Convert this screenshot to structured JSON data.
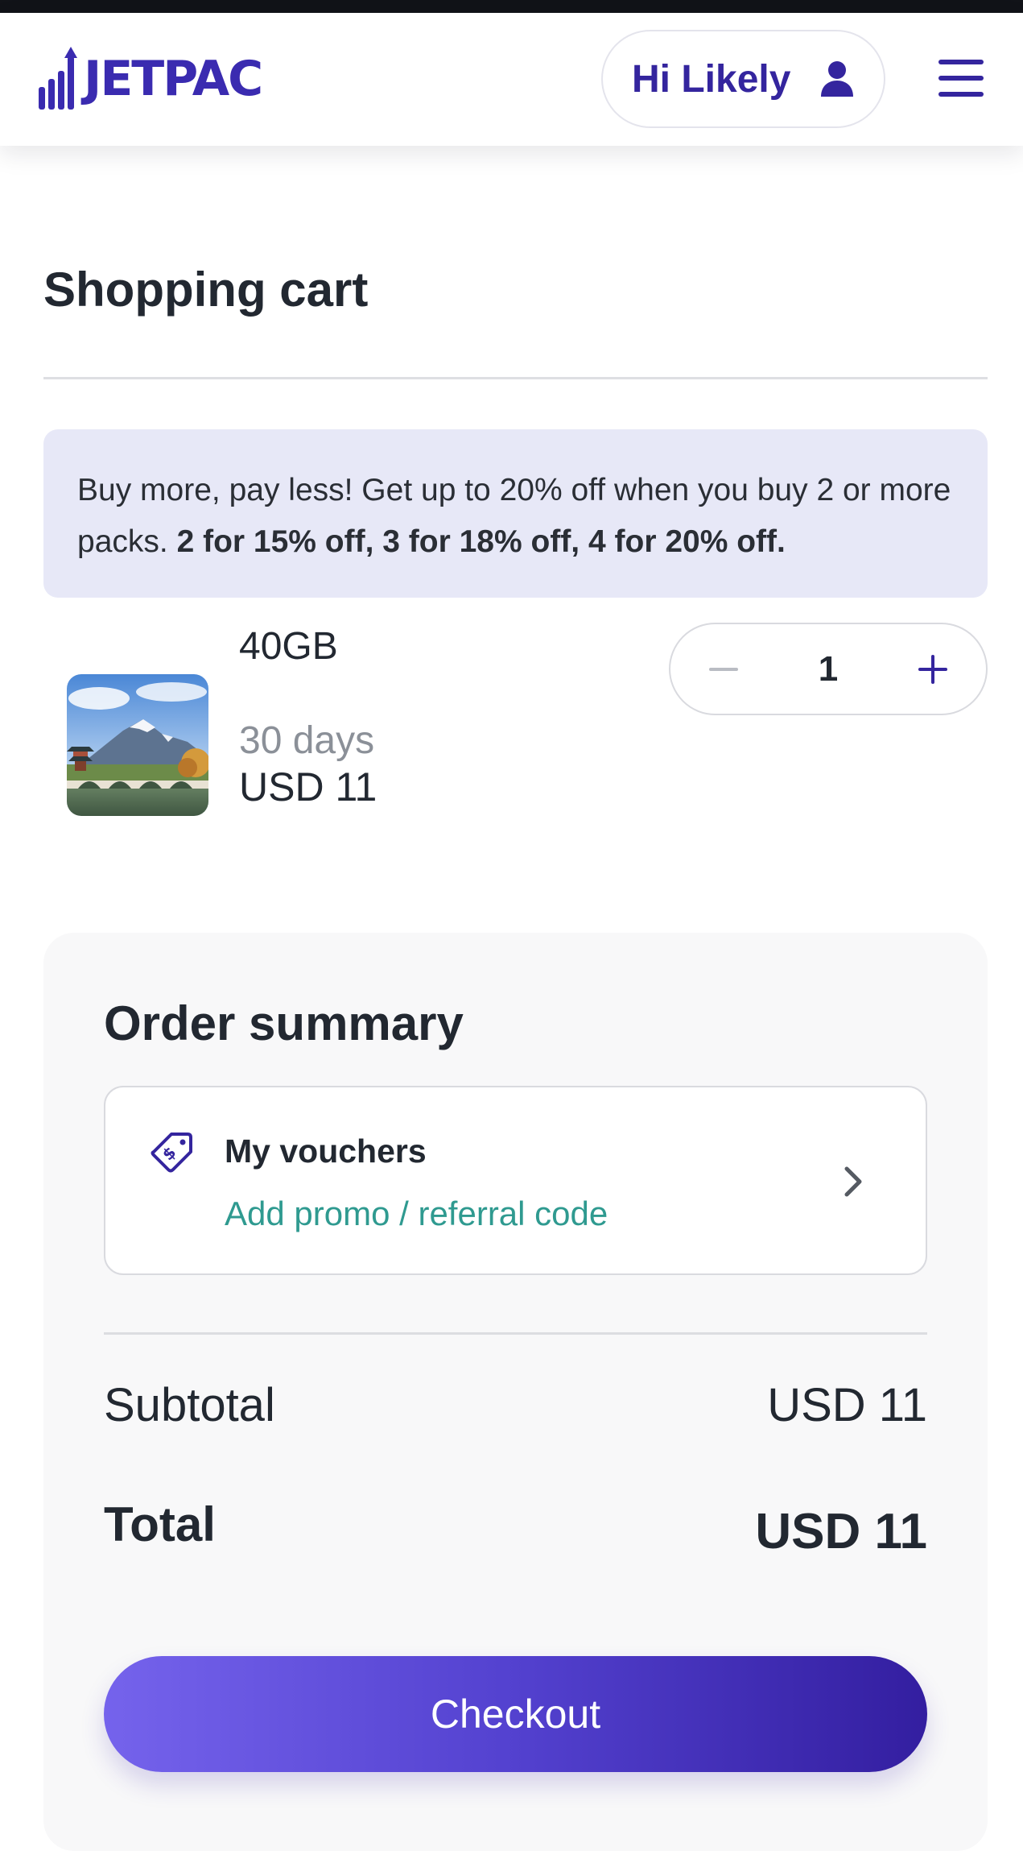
{
  "header": {
    "logo_text": "JETPAC",
    "greeting": "Hi Likely",
    "user_icon": "user-icon",
    "menu_icon": "hamburger-menu-icon"
  },
  "cart": {
    "title": "Shopping cart",
    "promo": {
      "lead": "Buy more, pay less! Get up to 20% off when you buy 2 or more packs.",
      "tiers": "2 for 15% off, 3 for 18% off, 4 for 20% off."
    },
    "item": {
      "name": "40GB",
      "duration": "30 days",
      "price": "USD 11",
      "quantity": "1",
      "decrement_icon": "minus-icon",
      "increment_icon": "plus-icon"
    }
  },
  "summary": {
    "title": "Order summary",
    "voucher": {
      "title": "My vouchers",
      "subtitle": "Add promo / referral code",
      "icon": "voucher-tag-icon",
      "chevron": "chevron-right-icon"
    },
    "subtotal_label": "Subtotal",
    "subtotal_value": "USD 11",
    "total_label": "Total",
    "total_value": "USD 11",
    "checkout_label": "Checkout"
  },
  "colors": {
    "brand": "#34259e",
    "promo_bg": "#e7e8f7",
    "link_teal": "#2f9a90",
    "checkout_start": "#7563ec",
    "checkout_end": "#331ea0"
  }
}
